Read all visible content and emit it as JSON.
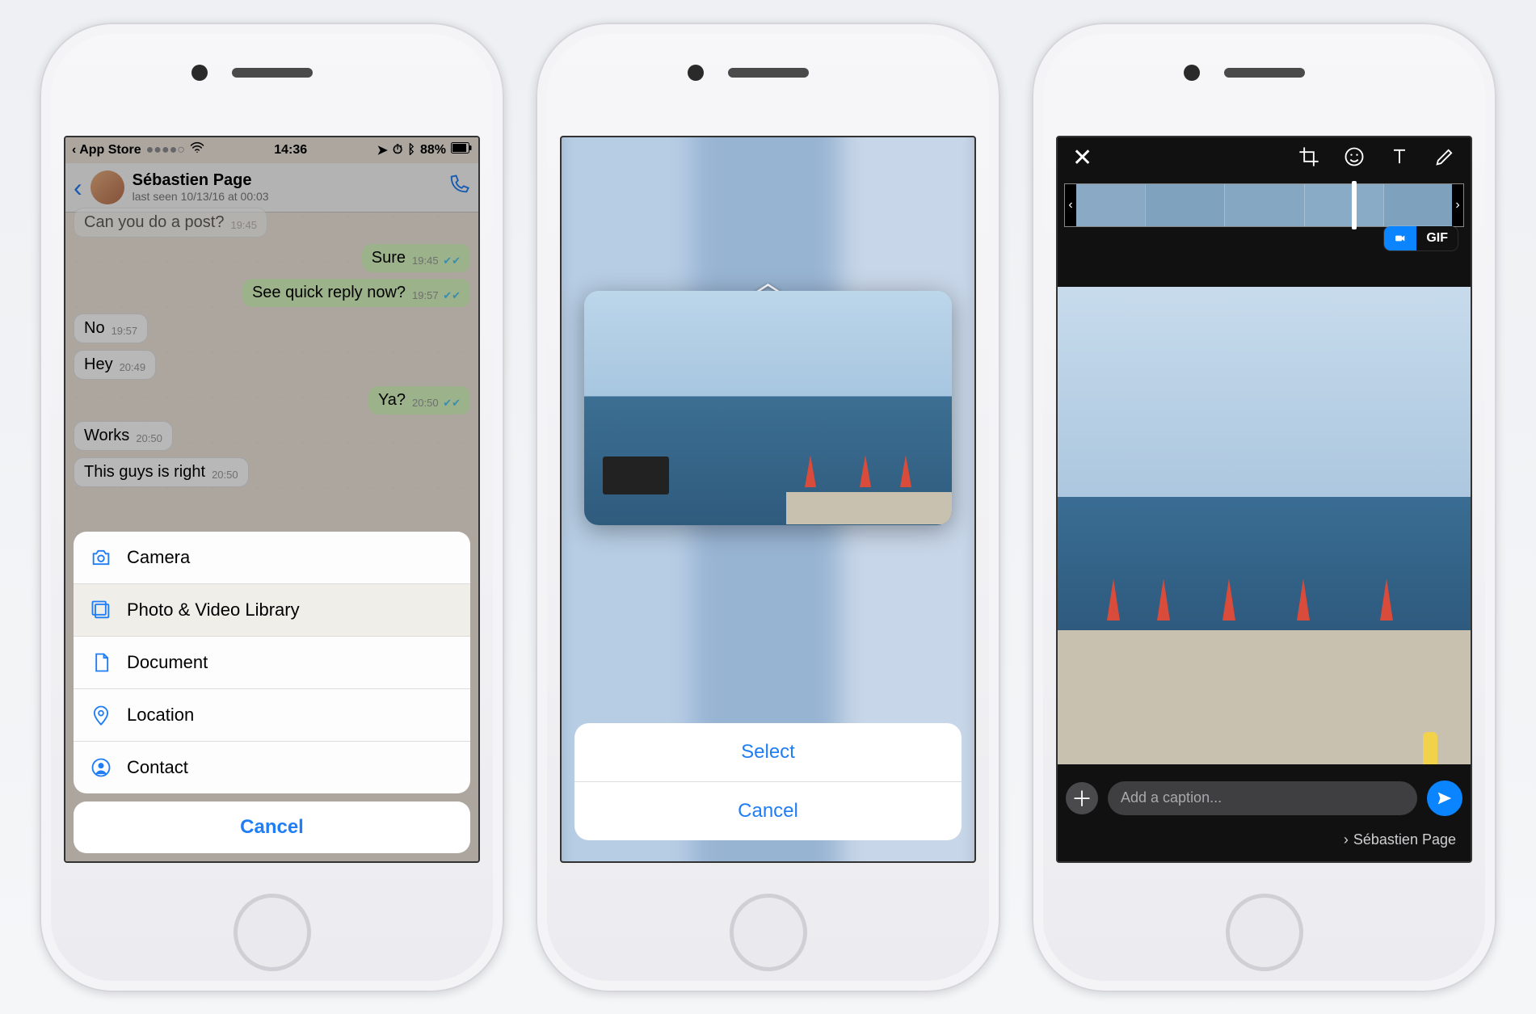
{
  "statusbar": {
    "back_app": "App Store",
    "carrier_dots": "●●●●○",
    "time": "14:36",
    "battery": "88%"
  },
  "chat": {
    "contact_name": "Sébastien Page",
    "last_seen": "last seen 10/13/16 at 00:03",
    "messages": {
      "m0_text": "Can you do a post?",
      "m0_time": "19:45",
      "m1_text": "Sure",
      "m1_time": "19:45",
      "m2_text": "See quick reply now?",
      "m2_time": "19:57",
      "m3_text": "No",
      "m3_time": "19:57",
      "m4_text": "Hey",
      "m4_time": "20:49",
      "m5_text": "Ya?",
      "m5_time": "20:50",
      "m6_text": "Works",
      "m6_time": "20:50",
      "m7_text": "This guys is right",
      "m7_time": "20:50"
    }
  },
  "attach_sheet": {
    "camera": "Camera",
    "library": "Photo & Video Library",
    "document": "Document",
    "location": "Location",
    "contact": "Contact",
    "cancel": "Cancel"
  },
  "picker": {
    "select": "Select",
    "cancel": "Cancel"
  },
  "editor": {
    "gif_label": "GIF",
    "caption_placeholder": "Add a caption...",
    "recipient": "Sébastien Page"
  }
}
